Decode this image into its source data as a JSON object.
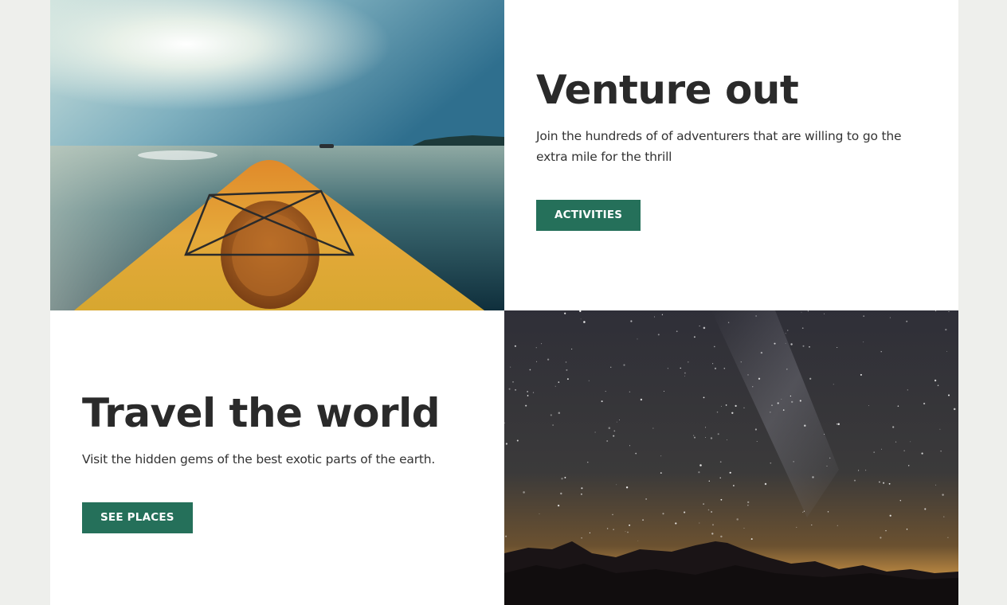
{
  "sections": [
    {
      "title": "Venture out",
      "description": "Join the hundreds of of adventurers that are willing to go the extra mile for the thrill",
      "button_label": "ACTIVITIES"
    },
    {
      "title": "Travel the world",
      "description": "Visit the hidden gems of the best exotic parts of the earth.",
      "button_label": "SEE PLACES"
    }
  ],
  "colors": {
    "accent": "#25705a",
    "page_background": "#eeefec",
    "heading": "#2a2a2a"
  },
  "images": {
    "kayak": "kayak-on-lake-photo",
    "night_sky": "milky-way-over-mountains-photo"
  }
}
